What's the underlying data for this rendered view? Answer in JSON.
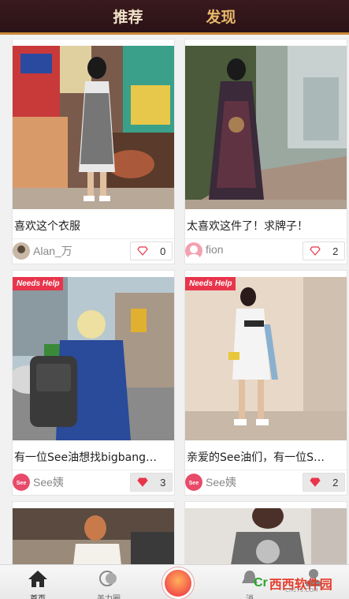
{
  "header": {
    "tabs": [
      {
        "label": "推荐"
      },
      {
        "label": "发现"
      }
    ],
    "active_tab": "发现"
  },
  "cards": [
    {
      "caption": "喜欢这个衣服",
      "author": "Alan_万",
      "likes": "0",
      "needs_help": false,
      "badge": ""
    },
    {
      "caption": "太喜欢这件了！求牌子！",
      "author": "fion",
      "likes": "2",
      "needs_help": false,
      "badge": ""
    },
    {
      "caption": "有一位See油想找bigbang…",
      "author": "See姨",
      "likes": "3",
      "needs_help": true,
      "badge": "Needs Help"
    },
    {
      "caption": "亲爱的See油们，有一位S…",
      "author": "See姨",
      "likes": "2",
      "needs_help": true,
      "badge": "Needs Help"
    }
  ],
  "bottom_nav": {
    "items": [
      {
        "label": "首页",
        "icon": "house-icon"
      },
      {
        "label": "美力圈",
        "icon": "circles-icon"
      },
      {
        "label": "",
        "icon": "camera-icon"
      },
      {
        "label": "消",
        "icon": "bell-icon"
      },
      {
        "label": "",
        "icon": "person-icon"
      }
    ]
  },
  "watermark": {
    "brand": "西西软件园",
    "url": "CR173.COM"
  },
  "colors": {
    "header_bg": "#2a1216",
    "accent": "#e8b86a",
    "badge": "#e8354b",
    "like_icon": "#e8354b"
  }
}
